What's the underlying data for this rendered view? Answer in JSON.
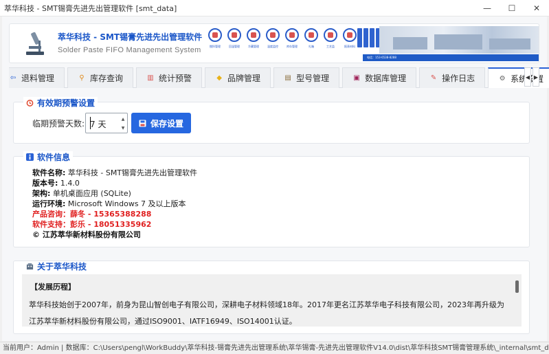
{
  "window": {
    "title": "萃华科技 - SMT锡膏先进先出管理软件 [smt_data]",
    "minimize": "—",
    "maximize": "☐",
    "close": "✕"
  },
  "banner": {
    "title_cn": "萃华科技 - SMT锡膏先进先出管理软件",
    "title_en": "Solder Paste FIFO Management System",
    "features": [
      "搅拌管理",
      "回温管理",
      "冷藏管理",
      "温度监控",
      "库存管理",
      "扎箱",
      "工艺监",
      "报表材料"
    ],
    "footer_text": "电话：153-6538-8288"
  },
  "tabs": [
    {
      "label": "退料管理",
      "icon": "return-icon",
      "active": false
    },
    {
      "label": "库存查询",
      "icon": "search-icon",
      "active": false
    },
    {
      "label": "统计预警",
      "icon": "chart-icon",
      "active": false
    },
    {
      "label": "品牌管理",
      "icon": "tag-icon",
      "active": false
    },
    {
      "label": "型号管理",
      "icon": "list-icon",
      "active": false
    },
    {
      "label": "数据库管理",
      "icon": "database-icon",
      "active": false
    },
    {
      "label": "操作日志",
      "icon": "log-icon",
      "active": false
    },
    {
      "label": "系统设置",
      "icon": "gear-icon",
      "active": true
    }
  ],
  "expiry": {
    "section_title": "有效期预警设置",
    "label": "临期预警天数:",
    "days": "7 天",
    "save_label": "保存设置"
  },
  "software": {
    "section_title": "软件信息",
    "name_label": "软件名称:",
    "name_value": "萃华科技 - SMT锡膏先进先出管理软件",
    "version_label": "版本号:",
    "version_value": "1.4.0",
    "arch_label": "架构:",
    "arch_value": "单机桌面应用 (SQLite)",
    "env_label": "运行环境:",
    "env_value": "Microsoft Windows 7 及以上版本",
    "consult": "产品咨询：薛冬 - 15365388288",
    "support": "软件支持：彭乐 - 18051335962",
    "copyright": "© 江苏萃华新材料股份有限公司"
  },
  "about": {
    "section_title": "关于萃华科技",
    "heading": "【发展历程】",
    "text": "萃华科技始创于2007年，前身为昆山智创电子有限公司，深耕电子材料领域18年。2017年更名江苏萃华电子科技有限公司，2023年再升级为江苏萃华新材料股份有限公司，通过ISO9001、IATF16949、ISO14001认证。"
  },
  "status": {
    "text": "当前用户：Admin | 数据库：C:\\Users\\pengl\\WorkBuddy\\萃华科技-锡膏先进先出管理系统\\萃华锡膏-先进先出管理软件V14.0\\dist\\萃华科技SMT锡膏管理系统\\_internal\\smt_data.db"
  },
  "colors": {
    "accent": "#2667e0",
    "section_title": "#1a56c8",
    "highlight_red": "#e02020"
  }
}
